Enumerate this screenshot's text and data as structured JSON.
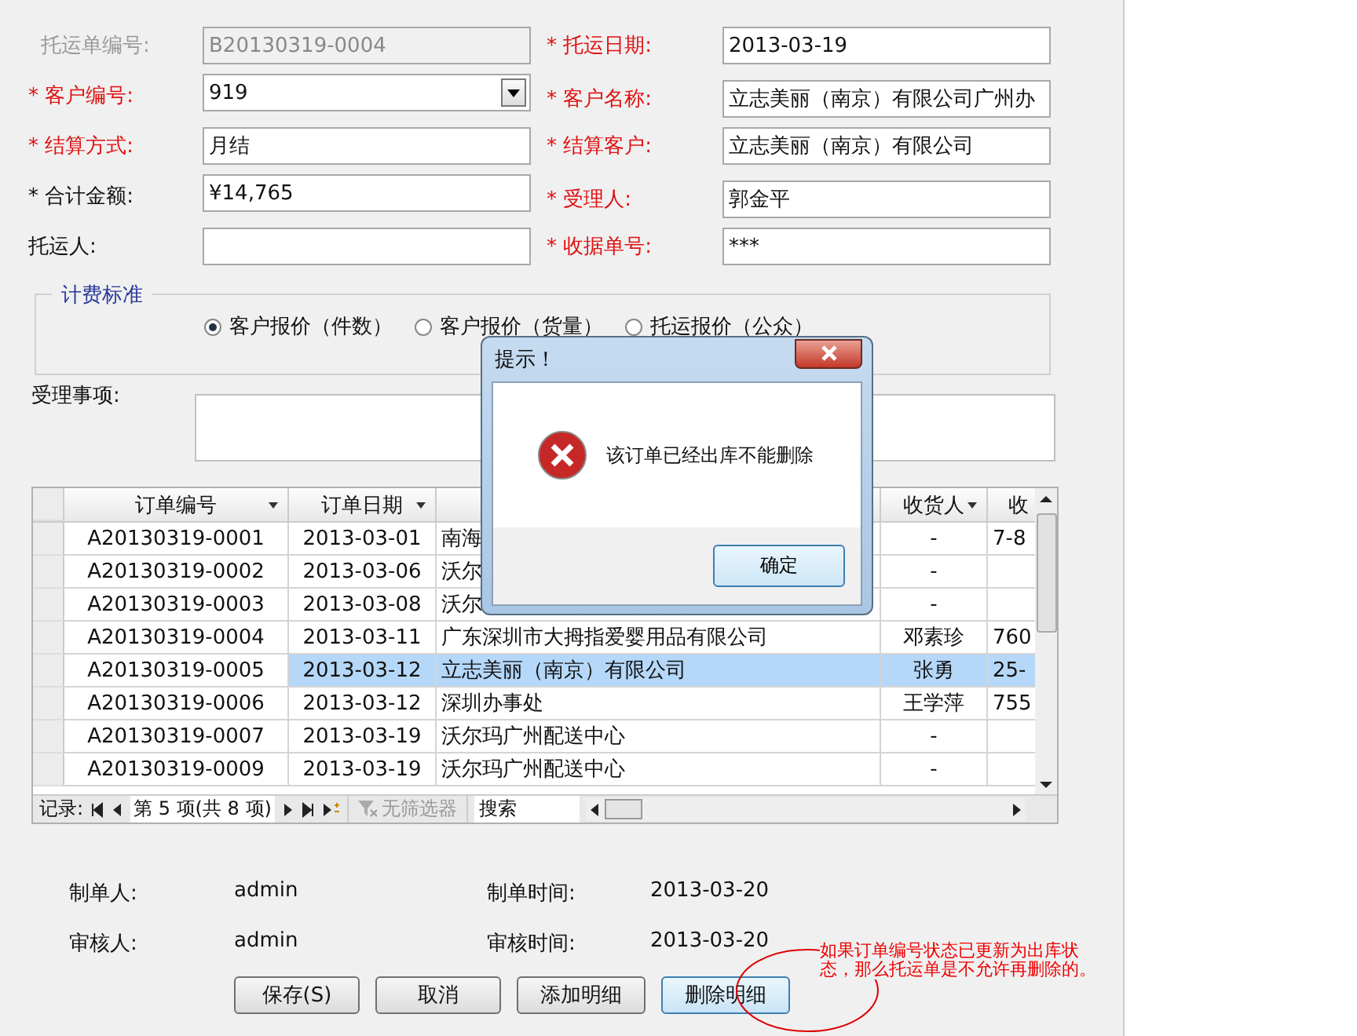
{
  "form": {
    "fields": [
      {
        "label": "托运单编号:",
        "value": "B20130319-0004",
        "required": false,
        "disabled": true,
        "kind": "text"
      },
      {
        "label": "* 托运日期:",
        "value": "2013-03-19",
        "required": true,
        "disabled": false,
        "kind": "text"
      },
      {
        "label": "* 客户编号:",
        "value": "919",
        "required": true,
        "disabled": false,
        "kind": "combo"
      },
      {
        "label": "* 客户名称:",
        "value": "立志美丽（南京）有限公司广州办",
        "required": true,
        "disabled": false,
        "kind": "text"
      },
      {
        "label": "* 结算方式:",
        "value": "月结",
        "required": true,
        "disabled": false,
        "kind": "text"
      },
      {
        "label": "* 结算客户:",
        "value": "立志美丽（南京）有限公司",
        "required": true,
        "disabled": false,
        "kind": "text"
      },
      {
        "label": "* 合计金额:",
        "value": "¥14,765",
        "required": false,
        "disabled": false,
        "kind": "text"
      },
      {
        "label": "* 受理人:",
        "value": "郭金平",
        "required": true,
        "disabled": false,
        "kind": "text"
      },
      {
        "label": "托运人:",
        "required": false,
        "disabled": false,
        "kind": "text"
      },
      {
        "label": "* 收据单号:",
        "value": "***",
        "required": true,
        "disabled": false,
        "kind": "text"
      }
    ]
  },
  "billing": {
    "legend": "计费标准",
    "options": [
      {
        "label": "客户报价（件数）",
        "selected": true
      },
      {
        "label": "客户报价（货量）",
        "selected": false
      },
      {
        "label": "托运报价（公众）",
        "selected": false
      }
    ]
  },
  "notes": {
    "label": "受理事项:"
  },
  "table": {
    "columns": [
      {
        "label": "订单编号"
      },
      {
        "label": "订单日期"
      },
      {},
      {
        "label": "收货人"
      },
      {
        "label": "收"
      }
    ],
    "rows": [
      {
        "cells": [
          "A20130319-0001",
          "2013-03-01",
          "南海",
          "-",
          "7-8"
        ],
        "selected": false
      },
      {
        "cells": [
          "A20130319-0002",
          "2013-03-06",
          "沃尔",
          "-",
          ""
        ],
        "selected": false
      },
      {
        "cells": [
          "A20130319-0003",
          "2013-03-08",
          "沃尔",
          "-",
          ""
        ],
        "selected": false
      },
      {
        "cells": [
          "A20130319-0004",
          "2013-03-11",
          "广东深圳市大拇指爱婴用品有限公司",
          "邓素珍",
          "760"
        ],
        "selected": false
      },
      {
        "cells": [
          "A20130319-0005",
          "2013-03-12",
          "立志美丽（南京）有限公司",
          "张勇",
          "25-"
        ],
        "selected": true
      },
      {
        "cells": [
          "A20130319-0006",
          "2013-03-12",
          "深圳办事处",
          "王学萍",
          "755"
        ],
        "selected": false
      },
      {
        "cells": [
          "A20130319-0007",
          "2013-03-19",
          "沃尔玛广州配送中心",
          "-",
          ""
        ],
        "selected": false
      },
      {
        "cells": [
          "A20130319-0009",
          "2013-03-19",
          "沃尔玛广州配送中心",
          "-",
          ""
        ],
        "selected": false
      }
    ],
    "nav": {
      "label": "记录:",
      "position": "第 5 项(共 8 项)",
      "filter": "无筛选器",
      "search": "搜索"
    }
  },
  "footer": [
    {
      "label": "制单人:",
      "value": "admin"
    },
    {
      "label": "制单时间:",
      "value": "2013-03-20"
    },
    {
      "label": "审核人:",
      "value": "admin"
    },
    {
      "label": "审核时间:",
      "value": "2013-03-20"
    }
  ],
  "buttons": [
    {
      "label": "保存(S)",
      "focused": false
    },
    {
      "label": "取消",
      "focused": false
    },
    {
      "label": "添加明细",
      "focused": false
    },
    {
      "label": "删除明细",
      "focused": true
    }
  ],
  "dialog": {
    "title": "提示！",
    "message": "该订单已经出库不能删除",
    "button": "确定"
  },
  "annotation": "如果订单编号状态已更新为出库状态，那么托运单是不允许再删除的。"
}
